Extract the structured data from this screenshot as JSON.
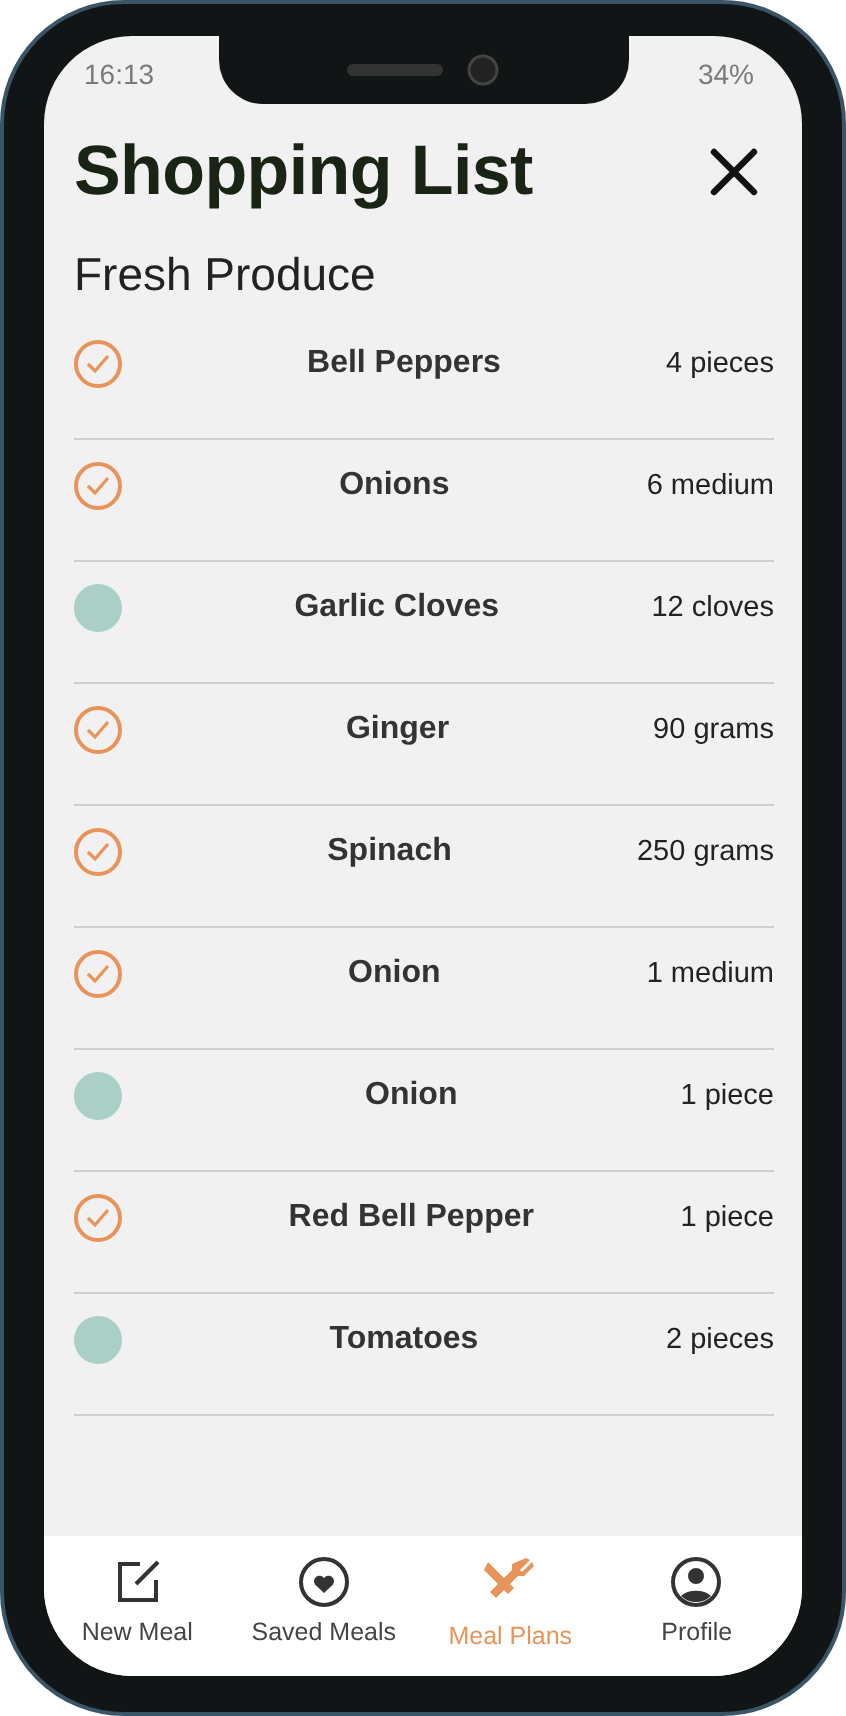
{
  "status_bar": {
    "time": "16:13",
    "battery": "34%"
  },
  "title": "Shopping List",
  "sections": [
    {
      "heading": "Fresh Produce",
      "items": [
        {
          "name": "Bell Peppers",
          "amount": "4 pieces",
          "checked": true
        },
        {
          "name": "Onions",
          "amount": "6 medium",
          "checked": true
        },
        {
          "name": "Garlic Cloves",
          "amount": "12 cloves",
          "checked": false
        },
        {
          "name": "Ginger",
          "amount": "90 grams",
          "checked": true
        },
        {
          "name": "Spinach",
          "amount": "250 grams",
          "checked": true
        },
        {
          "name": "Onion",
          "amount": "1 medium",
          "checked": true
        },
        {
          "name": "Onion",
          "amount": "1 piece",
          "checked": false
        },
        {
          "name": "Red Bell Pepper",
          "amount": "1 piece",
          "checked": true
        },
        {
          "name": "Tomatoes",
          "amount": "2 pieces",
          "checked": false
        }
      ]
    }
  ],
  "nav": [
    {
      "label": "New Meal",
      "kind": "edit",
      "selected": false
    },
    {
      "label": "Saved Meals",
      "kind": "heart",
      "selected": false
    },
    {
      "label": "Meal Plans",
      "kind": "utensils",
      "selected": true
    },
    {
      "label": "Profile",
      "kind": "profile",
      "selected": false
    }
  ]
}
